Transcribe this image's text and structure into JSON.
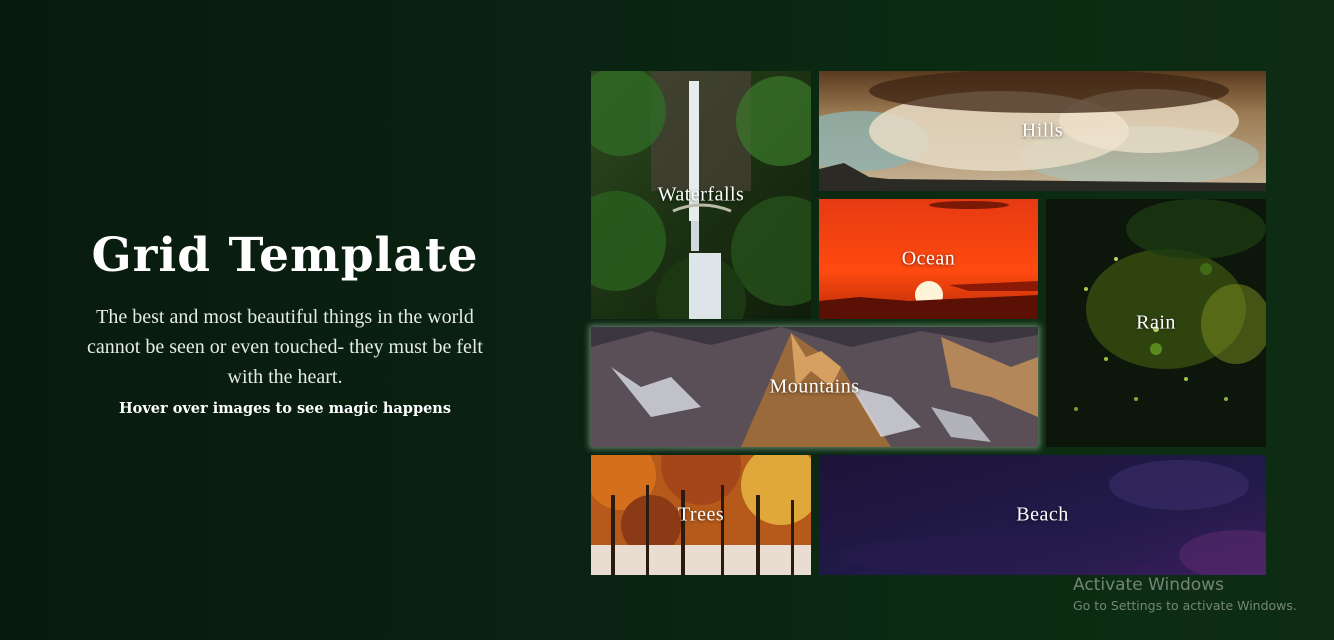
{
  "intro": {
    "title": "Grid Template",
    "lead": "The best and most beautiful things in the world cannot be seen or even touched- they must be felt with the heart.",
    "hint": "Hover over images to see magic happens"
  },
  "tiles": [
    {
      "label": "Waterfalls"
    },
    {
      "label": "Hills"
    },
    {
      "label": "Ocean"
    },
    {
      "label": "Rain"
    },
    {
      "label": "Mountains"
    },
    {
      "label": "Trees"
    },
    {
      "label": "Beach"
    }
  ],
  "watermark": {
    "title": "Activate Windows",
    "subtitle": "Go to Settings to activate Windows."
  }
}
